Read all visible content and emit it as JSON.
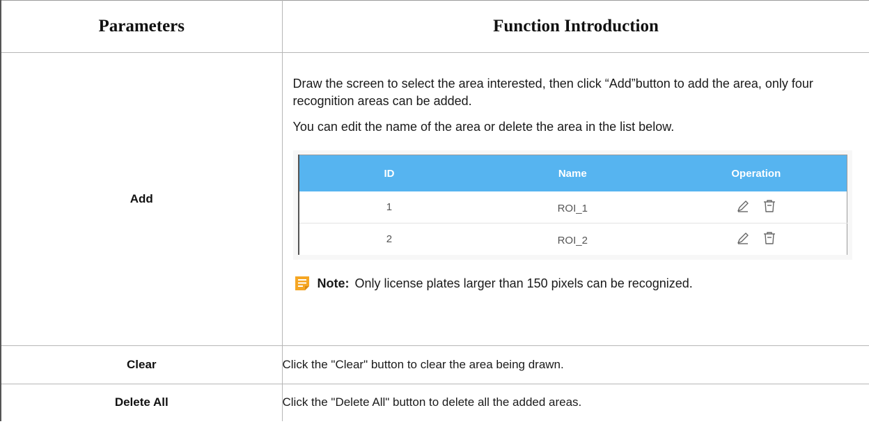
{
  "header": {
    "parameters": "Parameters",
    "function_introduction": "Function Introduction"
  },
  "rows": [
    {
      "param": "Add",
      "paragraphs": [
        "Draw the screen to select the area interested, then click “Add”button to add the area, only four recognition areas can be added.",
        "You can edit the name of the area or delete the area in the list below."
      ],
      "embedded_table": {
        "columns": [
          "ID",
          "Name",
          "Operation"
        ],
        "rows": [
          {
            "id": "1",
            "name": "ROI_1"
          },
          {
            "id": "2",
            "name": "ROI_2"
          }
        ],
        "header_color": "#56b4f0",
        "operation_icons": [
          "edit-pencil-icon",
          "delete-trash-icon"
        ]
      },
      "note": {
        "label": "Note:",
        "text": "Only license plates larger than 150 pixels can be recognized.",
        "icon": "note-icon",
        "icon_color": "#f5a623"
      }
    },
    {
      "param": "Clear",
      "text": "Click the \"Clear\" button to clear the area being drawn."
    },
    {
      "param": "Delete All",
      "text": "Click the \"Delete All\" button to delete all the added areas."
    }
  ]
}
